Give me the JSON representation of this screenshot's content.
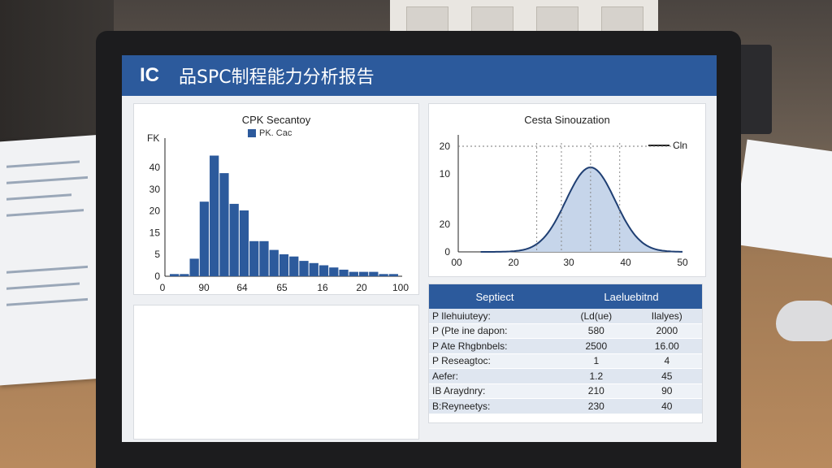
{
  "header": {
    "logo": "IC",
    "title": "品SPC制程能力分析报告"
  },
  "histogram": {
    "title": "CPK Secantoy",
    "legend": "PK. Cac",
    "y_top_label": "FK",
    "y_ticks": [
      "40",
      "30",
      "20",
      "15",
      "5",
      "0"
    ],
    "x_ticks": [
      "0",
      "90",
      "64",
      "65",
      "16",
      "20",
      "100"
    ]
  },
  "curve": {
    "title": "Cesta Sinouzation",
    "legend": "Cln",
    "y_ticks": [
      "20",
      "10",
      "20",
      "0"
    ],
    "x_ticks": [
      "00",
      "20",
      "30",
      "40",
      "50"
    ]
  },
  "table": {
    "headers": [
      "Septiect",
      "Laeluebitnd"
    ],
    "rows": [
      [
        "P Ilehuiuteyy:",
        "(Ld(ue)",
        "Ilalyes)"
      ],
      [
        "P (Pte ine dapon:",
        "580",
        "2000"
      ],
      [
        "P Ate Rhgbnbels:",
        "2500",
        "16.00"
      ],
      [
        "P Reseagtoc:",
        "1",
        "4"
      ],
      [
        "Aefer:",
        "1.2",
        "45"
      ],
      [
        "IB Araydnry:",
        "210",
        "90"
      ],
      [
        "B:Reyneetys:",
        "230",
        "40"
      ]
    ]
  },
  "chart_data": [
    {
      "type": "bar",
      "title": "CPK Secantoy",
      "series": [
        {
          "name": "PK. Cac",
          "values": [
            1,
            1,
            8,
            34,
            55,
            47,
            33,
            30,
            16,
            16,
            12,
            10,
            9,
            7,
            6,
            5,
            4,
            3,
            2,
            2,
            2,
            1,
            1
          ]
        }
      ],
      "ylim": [
        0,
        60
      ]
    },
    {
      "type": "area",
      "title": "Cesta Sinouzation",
      "series": [
        {
          "name": "Cln",
          "mean": 29.5,
          "sd": 5.5,
          "peak": 16
        }
      ],
      "xlim": [
        0,
        50
      ],
      "ylim": [
        0,
        20
      ]
    }
  ]
}
